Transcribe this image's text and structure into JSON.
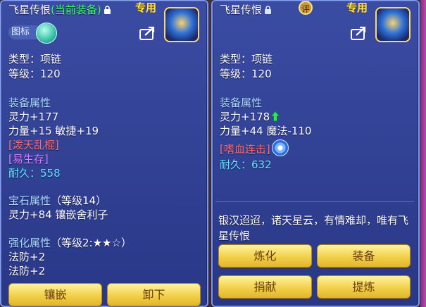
{
  "left": {
    "title": "飞星传恨",
    "current_tag": "(当前装备)",
    "exclusive": "专用",
    "tubiao_label": "图标",
    "type": "类型：项链",
    "level": "等级：120",
    "attr_header": "装备属性",
    "attr1": "灵力+177",
    "attr2": "力量+15 敏捷+19",
    "special1": "[泼天乱棍]",
    "special2": "[易生存]",
    "durability": "耐久：558",
    "gem_header": "宝石属性",
    "gem_level": "（等级14）",
    "gem_line": "灵力+84 镶嵌舍利子",
    "enhance_header": "强化属性",
    "enhance_level": "（等级2:★★☆）",
    "enhance1": "法防+2",
    "enhance2": "法防+2",
    "btn_inlay": "镶嵌",
    "btn_unequip": "卸下"
  },
  "right": {
    "title": "飞星传恨",
    "appraise_icon_text": "评",
    "exclusive": "专用",
    "type": "类型：项链",
    "level": "等级：120",
    "attr_header": "装备属性",
    "attr1": "灵力+178",
    "attr2": "力量+44 魔法-110",
    "special1": "[嗜血连击]",
    "durability": "耐久：632",
    "description": "银汉迢迢，诸天星云，有情难却，唯有飞星传恨",
    "btn_refine": "炼化",
    "btn_equip": "装备",
    "btn_donate": "捐献",
    "btn_extract": "提炼"
  },
  "colors": {
    "panel_blue": "#3a4eaa",
    "current_green": "#38ff5c",
    "exclusive_yellow": "#ffe34d",
    "section_blue": "#a9dcff",
    "special_red": "#ff6e6e",
    "special_purple": "#e27bff",
    "durability_cyan": "#5de9ff",
    "button_gold": "#f2d04a"
  }
}
